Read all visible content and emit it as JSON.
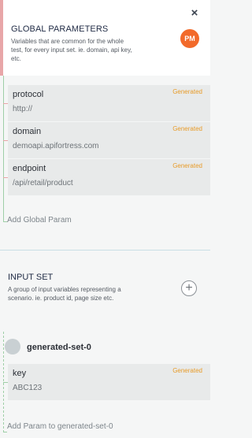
{
  "global": {
    "title": "GLOBAL PARAMETERS",
    "description_lines": [
      "Variables that are common for the whole",
      "test, for every input set. ie. domain, api key,",
      "etc."
    ],
    "badge": "PM",
    "close_icon": "close-icon",
    "params": [
      {
        "name": "protocol",
        "value": "http://",
        "tag": "Generated"
      },
      {
        "name": "domain",
        "value": "demoapi.apifortress.com",
        "tag": "Generated"
      },
      {
        "name": "endpoint",
        "value": "/api/retail/product",
        "tag": "Generated"
      }
    ],
    "add_label": "Add Global Param"
  },
  "input_set": {
    "title": "INPUT SET",
    "description_lines": [
      "A group of input variables representing a",
      "scenario. ie. product id, page size etc."
    ],
    "add_icon": "plus-circle-icon",
    "set_name": "generated-set-0",
    "params": [
      {
        "name": "key",
        "value": "ABC123",
        "tag": "Generated"
      }
    ],
    "add_label": "Add Param to generated-set-0"
  },
  "colors": {
    "accent_tag": "#e79b28",
    "badge": "#f26a2a",
    "global_bar": "#e8a6a8",
    "guide": "#9fcfa7"
  }
}
